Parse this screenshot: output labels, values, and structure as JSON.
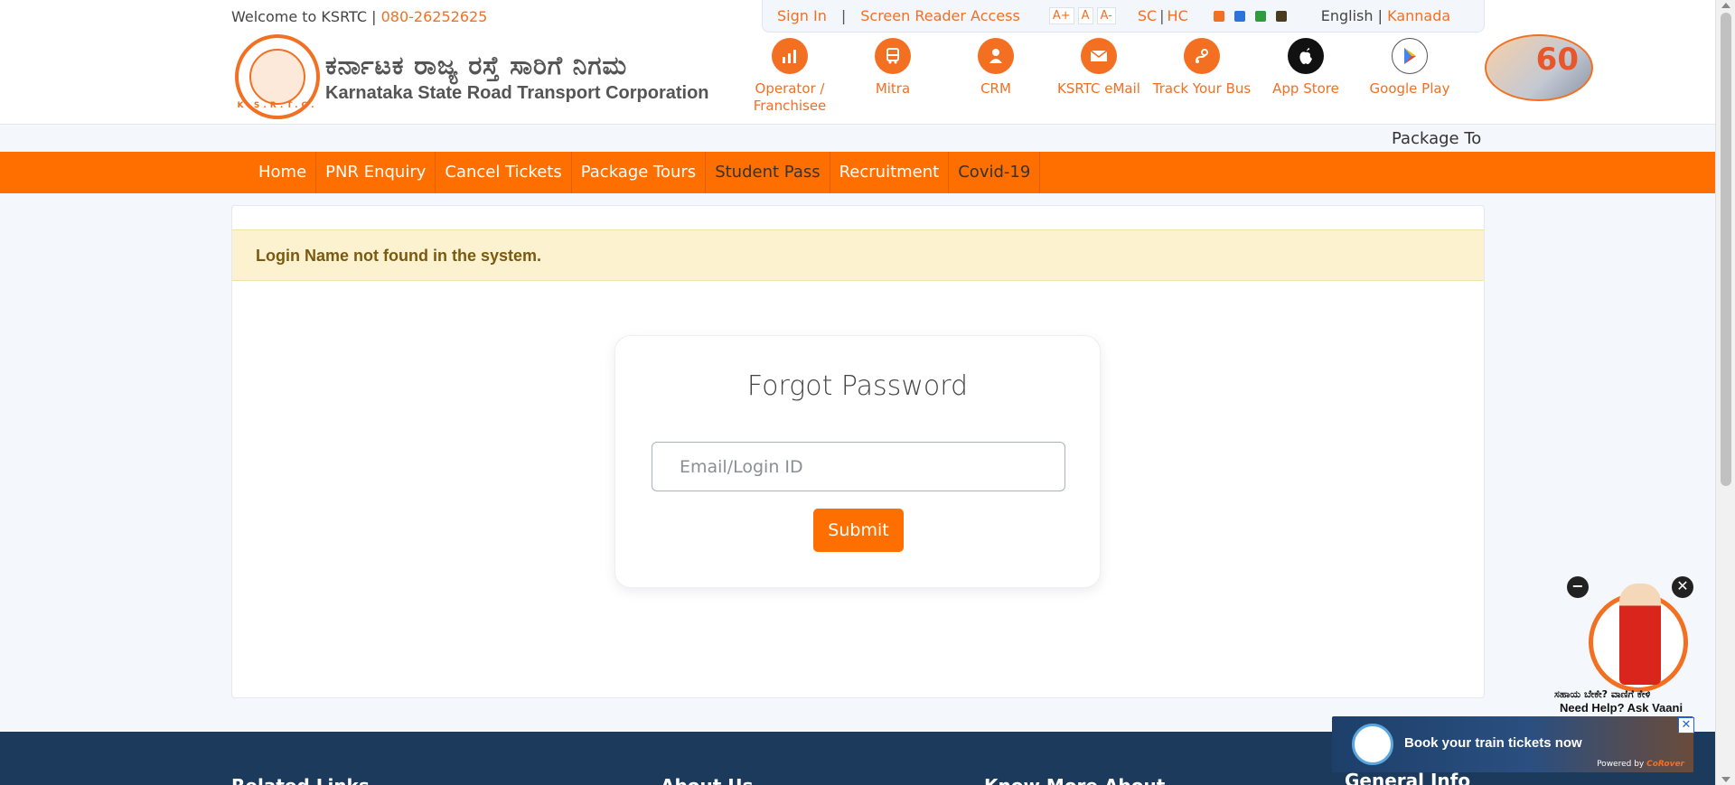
{
  "header": {
    "welcome_text": "Welcome to KSRTC |",
    "phone": "080-26252625",
    "sign_in": "Sign In",
    "separator": "|",
    "screen_reader": "Screen Reader Access",
    "font_larger": "A+",
    "font_normal": "A",
    "font_smaller": "A-",
    "contrast_sc": "SC",
    "contrast_hc": "HC",
    "contrast_sep": "|",
    "theme_colors": [
      "#f36f21",
      "#2d73d9",
      "#2e9b3d",
      "#4a3a1e"
    ],
    "lang_english": "English",
    "lang_sep": "|",
    "lang_kannada": "Kannada"
  },
  "logo": {
    "name_kannada": "ಕರ್ನಾಟಕ ರಾಜ್ಯ ರಸ್ತೆ ಸಾರಿಗೆ ನಿಗಮ",
    "name_english": "Karnataka State Road Transport Corporation",
    "emblem_text": "K.S.R.T.C."
  },
  "quick_links": [
    {
      "label": "Operator / Franchisee",
      "icon": "chart-icon"
    },
    {
      "label": "Mitra",
      "icon": "bus-icon"
    },
    {
      "label": "CRM",
      "icon": "user-icon"
    },
    {
      "label": "KSRTC eMail",
      "icon": "mail-icon"
    },
    {
      "label": "Track Your Bus",
      "icon": "route-icon"
    },
    {
      "label": "App Store",
      "icon": "apple-icon"
    },
    {
      "label": "Google Play",
      "icon": "play-icon"
    }
  ],
  "anniversary_badge": "60",
  "marquee_text": "Package To",
  "nav": {
    "items": [
      "Home",
      "PNR Enquiry",
      "Cancel Tickets",
      "Package Tours",
      "Student Pass",
      "Recruitment",
      "Covid-19"
    ]
  },
  "alert": {
    "message": "Login Name not found in the system."
  },
  "forgot_password": {
    "title": "Forgot Password",
    "email_placeholder": "Email/Login ID",
    "email_value": "",
    "submit_label": "Submit"
  },
  "footer": {
    "col1": "Related Links",
    "col2": "About Us",
    "col3": "Know More About",
    "col4": "General Info"
  },
  "chatbot": {
    "kannada_text": "ಸಹಾಯ ಬೇಕೇ? ವಾಣಿಗೆ ಕೇಳಿ",
    "english_text": "Need Help? Ask Vaani",
    "minimize_symbol": "−",
    "close_symbol": "✕"
  },
  "ad": {
    "text": "Book your train tickets now",
    "powered_label": "Powered by",
    "powered_brand": "CoRover",
    "close_symbol": "✕"
  }
}
